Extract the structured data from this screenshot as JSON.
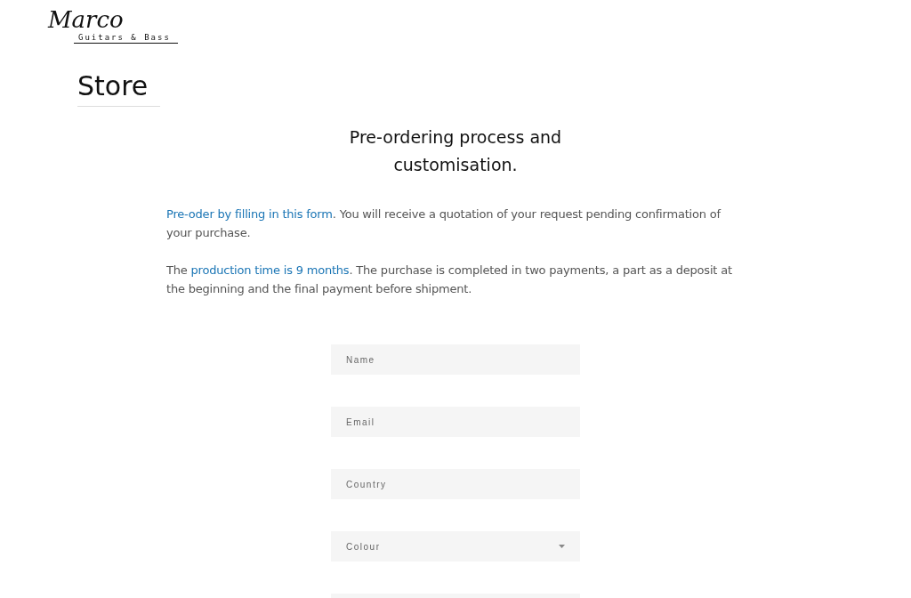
{
  "logo": {
    "name": "Marco",
    "tagline": "Guitars & Bass"
  },
  "page_title": "Store",
  "heading": "Pre-ordering process and customisation.",
  "paragraphs": [
    [
      {
        "kind": "link",
        "text": "Pre-oder by filling in this form"
      },
      {
        "kind": "text",
        "text": ". You will receive a quotation of your request pending confirmation of your purchase."
      }
    ],
    [
      {
        "kind": "text",
        "text": "The "
      },
      {
        "kind": "link",
        "text": "production time is 9 months"
      },
      {
        "kind": "text",
        "text": ". The purchase is completed in two payments, a part as a deposit at the beginning and the final payment before shipment."
      }
    ]
  ],
  "form": {
    "fields": [
      {
        "kind": "input",
        "placeholder": "Name"
      },
      {
        "kind": "input",
        "placeholder": "Email"
      },
      {
        "kind": "input",
        "placeholder": "Country"
      },
      {
        "kind": "select",
        "placeholder": "Colour"
      },
      {
        "kind": "input"
      }
    ]
  }
}
